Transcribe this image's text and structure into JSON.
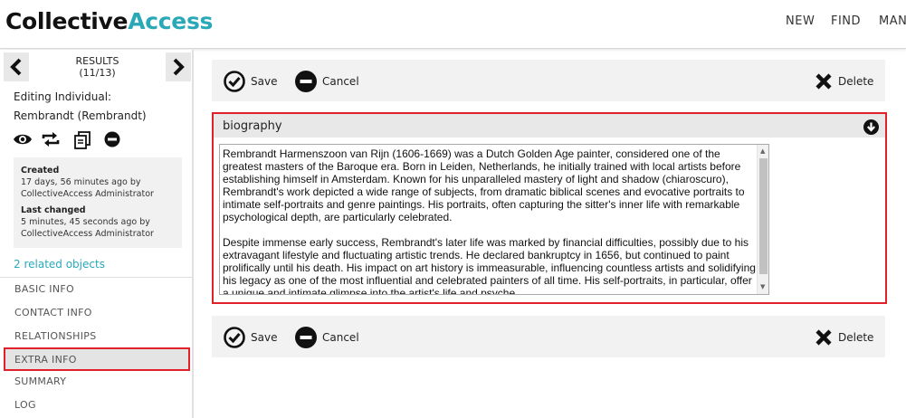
{
  "header": {
    "logo_part1": "Collective",
    "logo_part2": "Access",
    "nav": [
      "NEW",
      "FIND",
      "MANA"
    ]
  },
  "sidebar": {
    "results_label": "RESULTS",
    "results_count": "(11/13)",
    "editing_label": "Editing Individual:",
    "editing_name": "Rembrandt (Rembrandt)",
    "action_icons": [
      "eye-icon",
      "refresh-icon",
      "duplicate-icon",
      "minus-circle-icon"
    ],
    "meta": {
      "created_label": "Created",
      "created_value_line1": "17 days, 56 minutes ago by",
      "created_value_line2": "CollectiveAccess Administrator",
      "changed_label": "Last changed",
      "changed_value_line1": "5 minutes, 45 seconds ago by",
      "changed_value_line2": "CollectiveAccess Administrator"
    },
    "related_link": "2 related objects",
    "items": [
      "BASIC INFO",
      "CONTACT INFO",
      "RELATIONSHIPS",
      "EXTRA INFO",
      "SUMMARY",
      "LOG"
    ],
    "active_item": "EXTRA INFO"
  },
  "toolbar": {
    "save_label": "Save",
    "cancel_label": "Cancel",
    "delete_label": "Delete"
  },
  "panel": {
    "title": "biography",
    "paragraph1": "Rembrandt Harmenszoon van Rijn (1606-1669) was a Dutch Golden Age painter, considered one of the greatest masters of the Baroque era.  Born in Leiden, Netherlands, he initially trained with local artists before establishing himself in Amsterdam.  Known for his unparalleled mastery of light and shadow (chiaroscuro), Rembrandt's work depicted a wide range of subjects, from dramatic biblical scenes and evocative portraits to intimate self-portraits and genre paintings.  His portraits, often capturing the sitter's inner life with remarkable psychological depth, are particularly celebrated.",
    "paragraph2": "Despite immense early success, Rembrandt's later life was marked by financial difficulties, possibly due to his extravagant lifestyle and fluctuating artistic trends.  He declared bankruptcy in 1656, but continued to paint prolifically until his death. His impact on art history is immeasurable, influencing countless artists and solidifying his legacy as one of the most influential and celebrated painters of all time.  His self-portraits, in particular, offer a unique and intimate glimpse into the artist's life and psyche."
  },
  "colors": {
    "brand": "#29a8b8",
    "highlight": "#e0202a"
  }
}
